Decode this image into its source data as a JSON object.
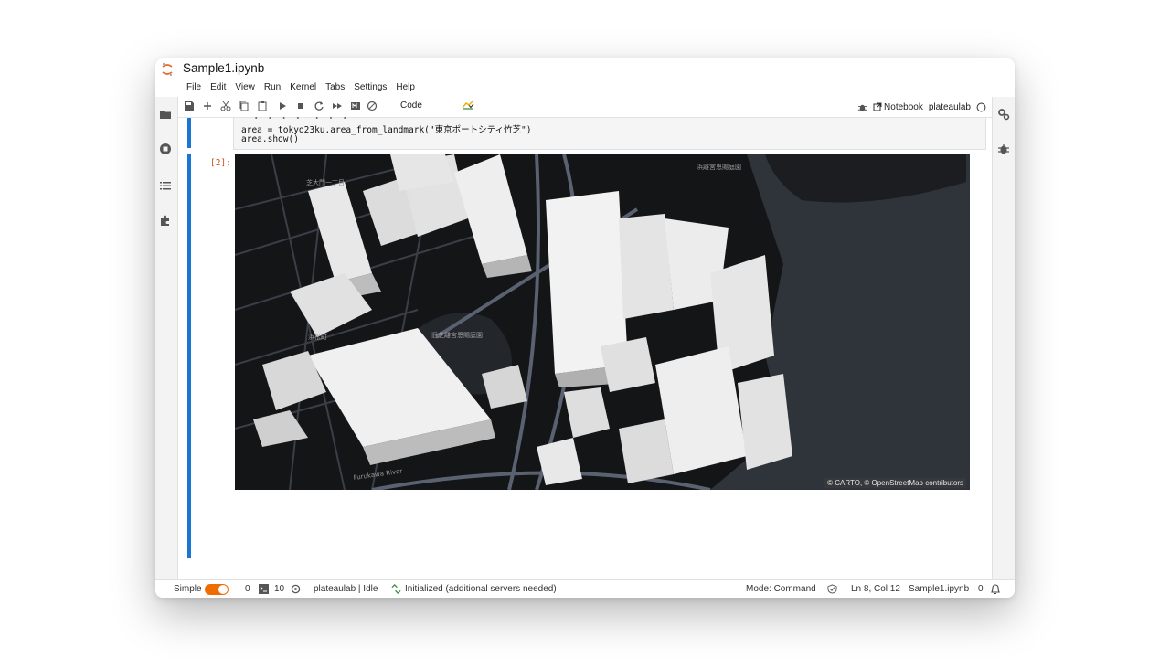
{
  "app": {
    "title": "Sample1.ipynb"
  },
  "menu": [
    "File",
    "Edit",
    "View",
    "Run",
    "Kernel",
    "Tabs",
    "Settings",
    "Help"
  ],
  "toolbar": {
    "cell_type": "Code",
    "notebook_label": "Notebook",
    "kernel_name": "plateaulab",
    "icons": [
      "save-icon",
      "add-icon",
      "cut-icon",
      "copy-icon",
      "paste-icon",
      "run-icon",
      "stop-icon",
      "restart-icon",
      "fast-forward-icon",
      "markdown-icon",
      "git-icon",
      "chevron-down-icon",
      "bug-icon",
      "kernel-status-icon"
    ]
  },
  "cell": {
    "code_line1": "area = tokyo23ku.area_from_landmark(\"東京ポートシティ竹芝\")",
    "code_line2": "area.show()",
    "output_prompt": "[2]:"
  },
  "map": {
    "attribution": "© CARTO, © OpenStreetMap contributors",
    "labels": [
      "芝大門一丁目",
      "浜松町",
      "旧芝離宮恩賜庭園",
      "浜離宮恩賜庭園",
      "Furukawa River"
    ]
  },
  "status": {
    "mode_label": "Simple",
    "count_a": "0",
    "count_b": "10",
    "kernel": "plateaulab | Idle",
    "lsp": "Initialized (additional servers needed)",
    "mode": "Mode: Command",
    "position": "Ln 8, Col 12",
    "file": "Sample1.ipynb",
    "notifications": "0"
  },
  "colors": {
    "accent": "#1976d2",
    "toggle": "#ef6c00",
    "map_bg": "#2a2d33"
  }
}
